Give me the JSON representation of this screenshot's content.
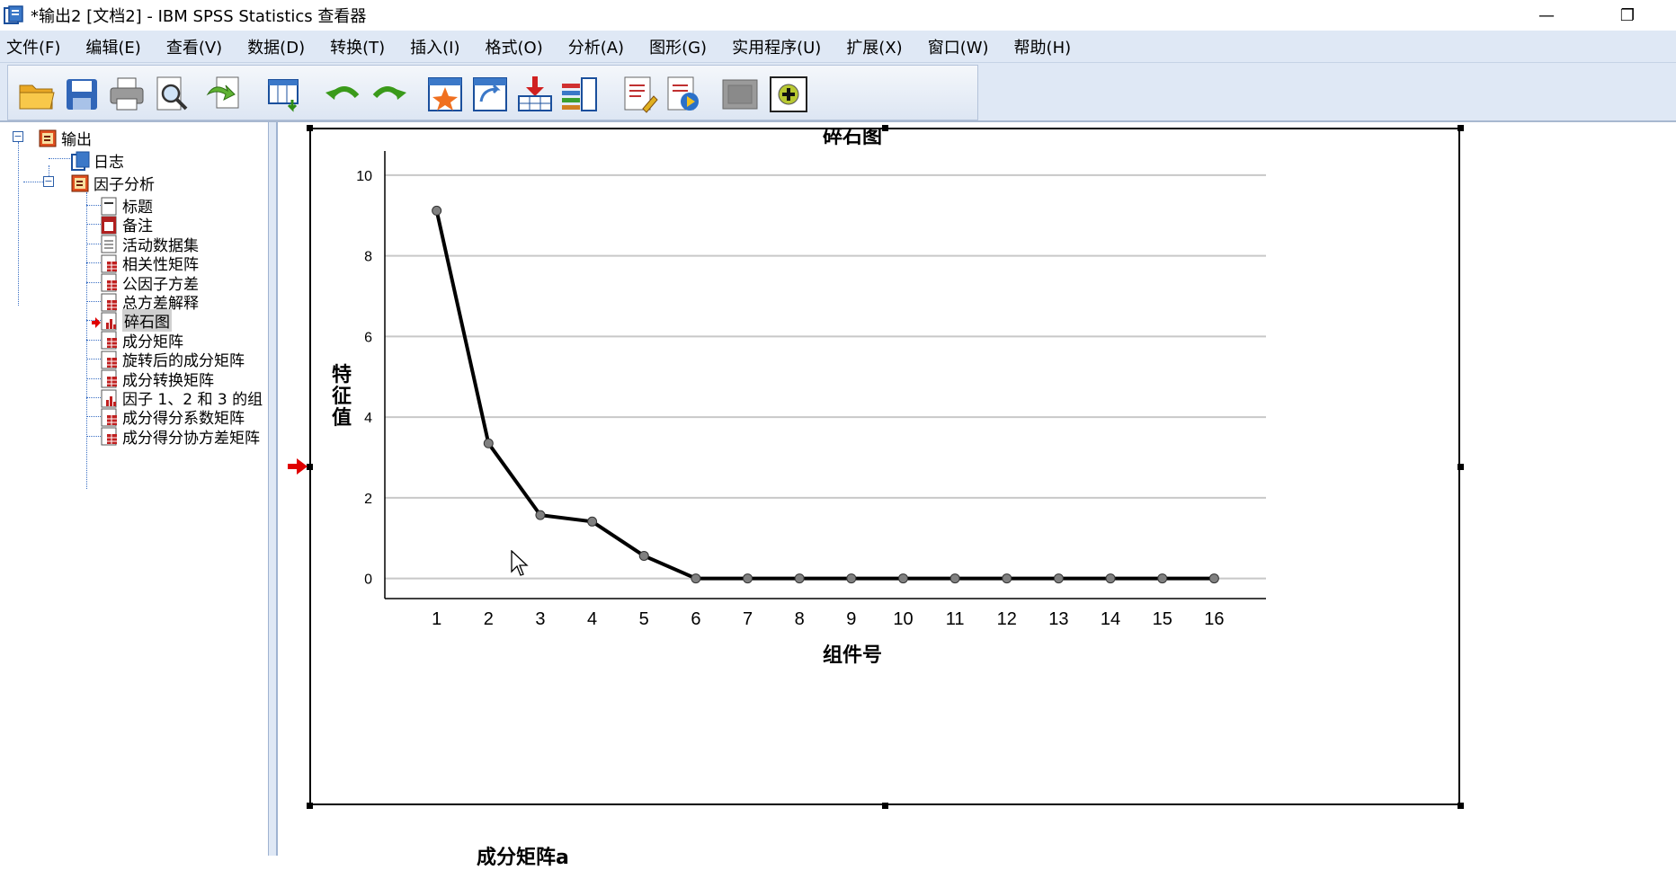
{
  "window": {
    "title": "*输出2 [文档2] - IBM SPSS Statistics 查看器",
    "minimize": "—",
    "restore": "❐"
  },
  "menu": [
    "文件(F)",
    "编辑(E)",
    "查看(V)",
    "数据(D)",
    "转换(T)",
    "插入(I)",
    "格式(O)",
    "分析(A)",
    "图形(G)",
    "实用程序(U)",
    "扩展(X)",
    "窗口(W)",
    "帮助(H)"
  ],
  "toolbar": {
    "icons": [
      "open-folder-icon",
      "save-icon",
      "print-icon",
      "print-preview-icon",
      "export-icon",
      "goto-data-icon",
      "undo-icon",
      "redo-icon",
      "goto-case-icon",
      "goto-variable-icon",
      "insert-cases-icon",
      "variables-icon",
      "insert-text-icon",
      "insert-script-icon",
      "hide-icon",
      "show-icon"
    ]
  },
  "tree": {
    "root": "输出",
    "log": "日志",
    "group": "因子分析",
    "items": [
      "标题",
      "备注",
      "活动数据集",
      "相关性矩阵",
      "公因子方差",
      "总方差解释",
      "碎石图",
      "成分矩阵",
      "旋转后的成分矩阵",
      "成分转换矩阵",
      "因子 1、2 和 3 的组",
      "成分得分系数矩阵",
      "成分得分协方差矩阵"
    ],
    "selected_index": 6
  },
  "chart_data": {
    "type": "line",
    "title": "碎石图",
    "xlabel": "组件号",
    "ylabel": "特征值",
    "x": [
      1,
      2,
      3,
      4,
      5,
      6,
      7,
      8,
      9,
      10,
      11,
      12,
      13,
      14,
      15,
      16
    ],
    "y": [
      9.12,
      3.35,
      1.57,
      1.41,
      0.56,
      0.0,
      0.0,
      0.0,
      0.0,
      0.0,
      0.0,
      0.0,
      0.0,
      0.0,
      0.0,
      0.0
    ],
    "ylim": [
      -0.5,
      10.6
    ],
    "yticks": [
      0,
      2,
      4,
      6,
      8,
      10
    ],
    "grid": true
  },
  "below_text": "成分矩阵a",
  "colors": {
    "line": "#000000",
    "marker": "#808080",
    "grid": "#c8c8c8",
    "menubar": "#dfe8f5",
    "arrow": "#e00000"
  }
}
